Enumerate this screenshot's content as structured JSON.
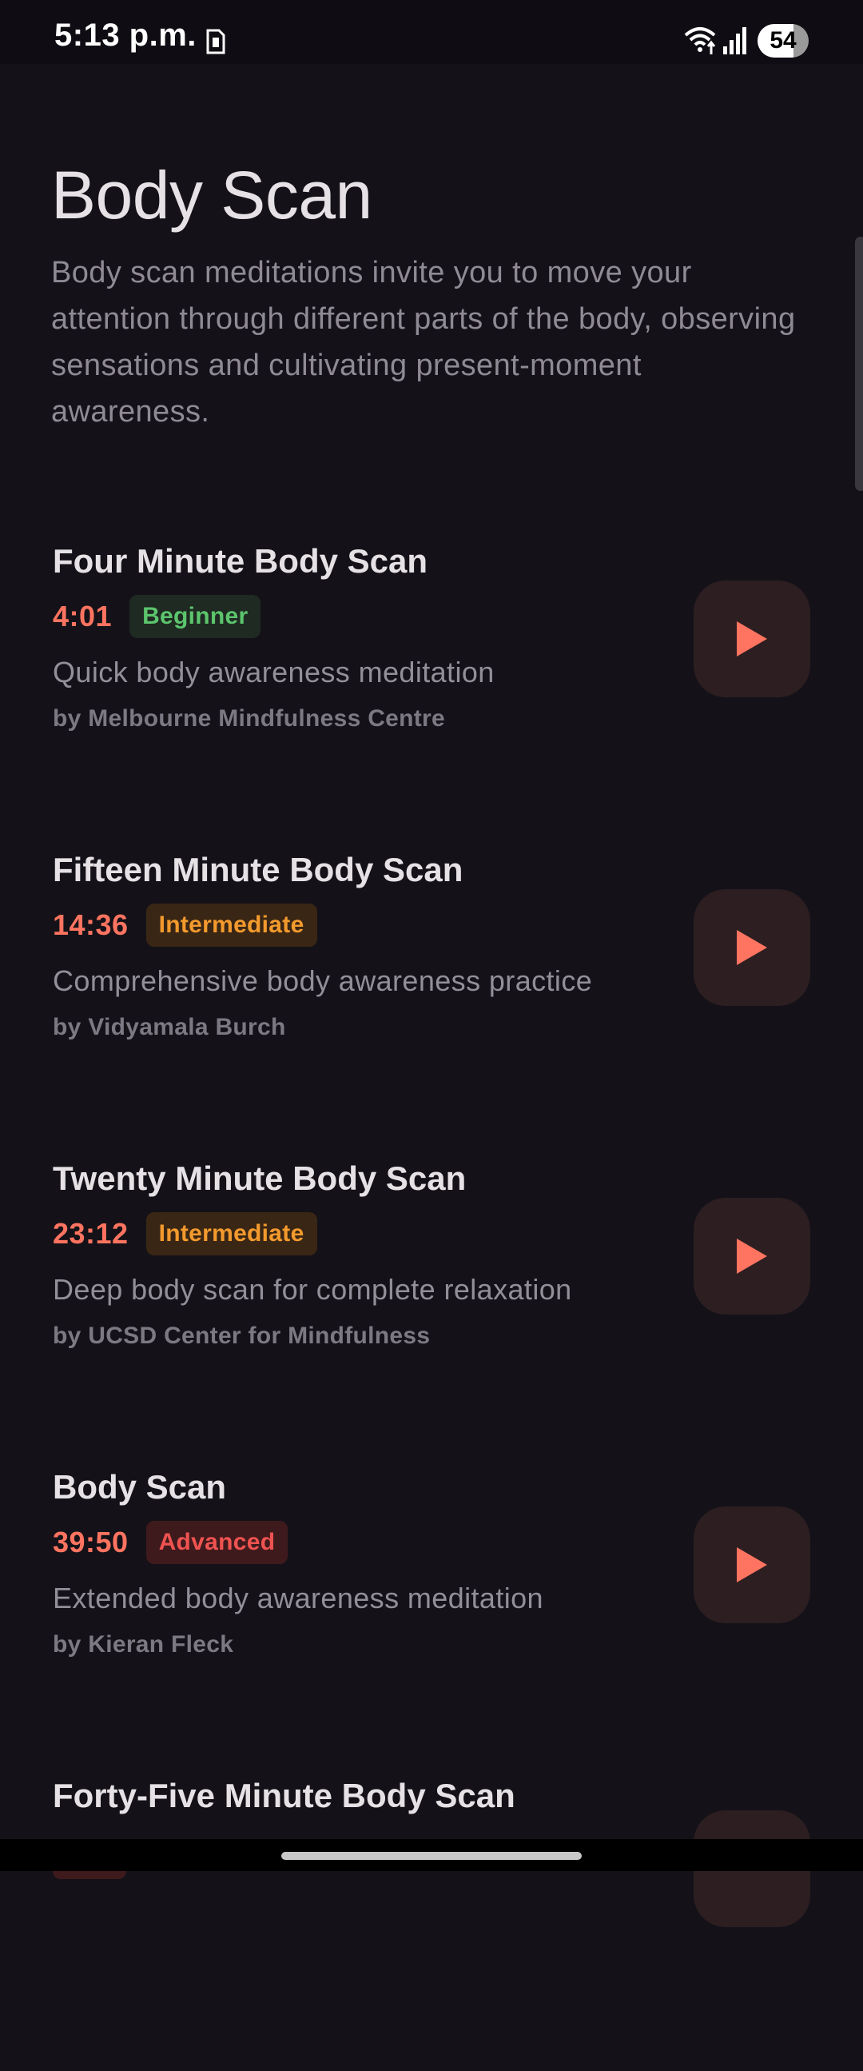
{
  "status_bar": {
    "time": "5:13 p.m.",
    "battery": "54",
    "icons": [
      "sim-card-icon",
      "wifi-icon",
      "signal-icon",
      "battery-icon"
    ]
  },
  "page": {
    "title": "Body Scan",
    "description": "Body scan meditations invite you to move your attention through different parts of the body, observing sensations and cultivating present-moment awareness."
  },
  "colors": {
    "background": "#141218",
    "accent": "#ff7460",
    "beginner": "#5cc56d",
    "intermediate": "#f39a2e",
    "advanced": "#ef5350"
  },
  "meditations": [
    {
      "title": "Four Minute Body Scan",
      "duration": "4:01",
      "level": "Beginner",
      "description": "Quick body awareness meditation",
      "author": "by Melbourne Mindfulness Centre"
    },
    {
      "title": "Fifteen Minute Body Scan",
      "duration": "14:36",
      "level": "Intermediate",
      "description": "Comprehensive body awareness practice",
      "author": "by Vidyamala Burch"
    },
    {
      "title": "Twenty Minute Body Scan",
      "duration": "23:12",
      "level": "Intermediate",
      "description": "Deep body scan for complete relaxation",
      "author": "by UCSD Center for Mindfulness"
    },
    {
      "title": "Body Scan",
      "duration": "39:50",
      "level": "Advanced",
      "description": "Extended body awareness meditation",
      "author": "by Kieran Fleck"
    },
    {
      "title": "Forty-Five Minute Body Scan"
    }
  ]
}
